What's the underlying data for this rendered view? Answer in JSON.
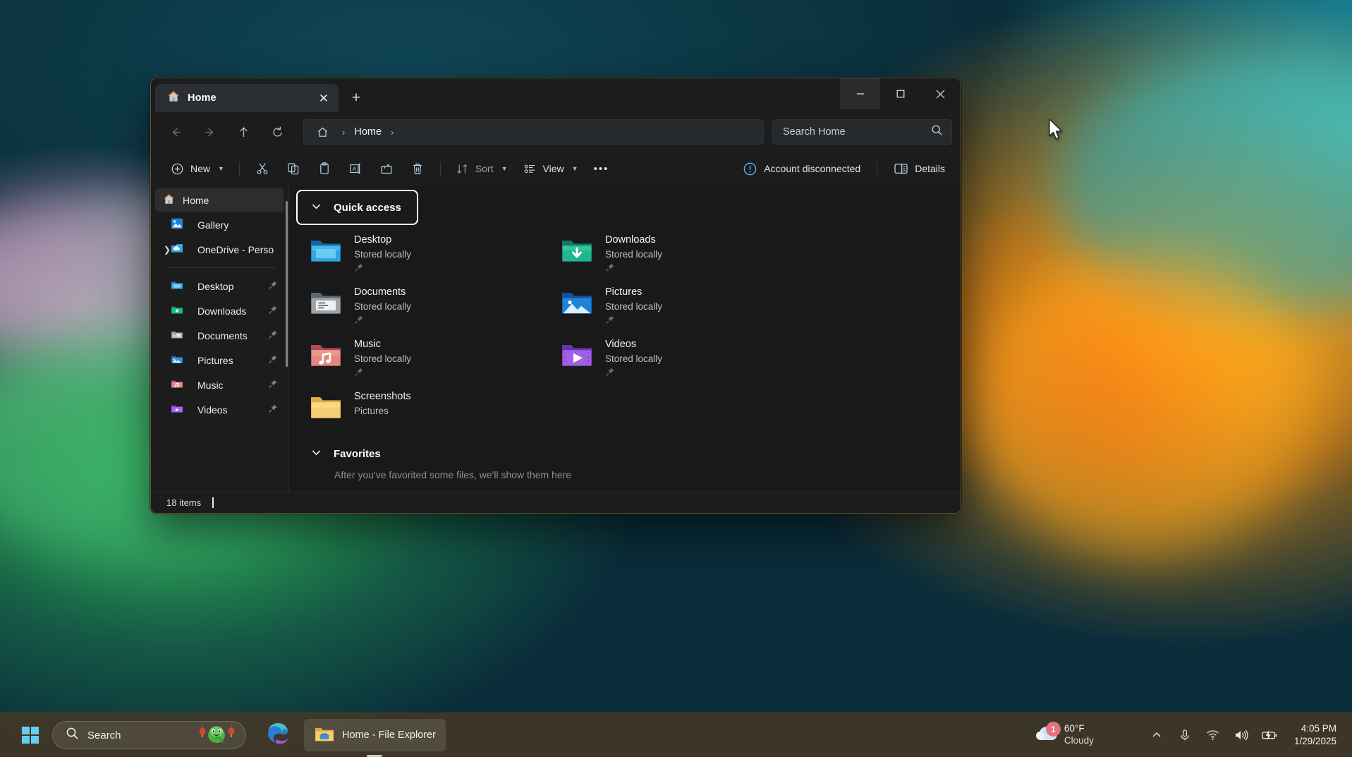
{
  "window": {
    "tab": {
      "title": "Home",
      "icon": "home-icon",
      "close_label": "✕"
    },
    "new_tab_label": "+",
    "controls": {
      "minimize": "minimize-icon",
      "maximize": "maximize-icon",
      "close": "close-icon"
    }
  },
  "nav": {
    "back": "back-arrow-icon",
    "forward": "forward-arrow-icon",
    "up": "up-arrow-icon",
    "refresh": "refresh-icon",
    "breadcrumb": {
      "home_icon": "home-icon",
      "sep1": "›",
      "label": "Home",
      "sep2": "›"
    },
    "search": {
      "placeholder": "Search Home",
      "icon": "search-icon"
    }
  },
  "commandbar": {
    "new_label": "New",
    "cut": "cut-icon",
    "copy": "copy-icon",
    "paste": "paste-icon",
    "rename": "rename-icon",
    "share": "share-icon",
    "delete": "delete-icon",
    "sort_label": "Sort",
    "view_label": "View",
    "more_label": "•••",
    "account_label": "Account disconnected",
    "details_label": "Details",
    "accent": "#4cc2ff"
  },
  "sidebar": {
    "items": [
      {
        "label": "Home",
        "icon": "home-icon",
        "selected": true,
        "expander": false,
        "pin": false,
        "indent": false
      },
      {
        "label": "Gallery",
        "icon": "gallery-icon",
        "selected": false,
        "expander": false,
        "pin": false,
        "indent": true
      },
      {
        "label": "OneDrive - Perso",
        "icon": "onedrive-icon",
        "selected": false,
        "expander": true,
        "pin": false,
        "indent": true
      }
    ],
    "pinned": [
      {
        "label": "Desktop",
        "icon": "desktop-folder-icon",
        "pin": true
      },
      {
        "label": "Downloads",
        "icon": "downloads-folder-icon",
        "pin": true
      },
      {
        "label": "Documents",
        "icon": "documents-folder-icon",
        "pin": true
      },
      {
        "label": "Pictures",
        "icon": "pictures-folder-icon",
        "pin": true
      },
      {
        "label": "Music",
        "icon": "music-folder-icon",
        "pin": true
      },
      {
        "label": "Videos",
        "icon": "videos-folder-icon",
        "pin": true
      }
    ]
  },
  "content": {
    "quick_access": {
      "title": "Quick access",
      "chevron": "chevron-down-icon",
      "focused": true,
      "items": [
        {
          "name": "Desktop",
          "sub": "Stored locally",
          "icon": "desktop-folder-icon",
          "pinned": true
        },
        {
          "name": "Downloads",
          "sub": "Stored locally",
          "icon": "downloads-folder-icon",
          "pinned": true
        },
        {
          "name": "Documents",
          "sub": "Stored locally",
          "icon": "documents-folder-icon",
          "pinned": true
        },
        {
          "name": "Pictures",
          "sub": "Stored locally",
          "icon": "pictures-folder-icon",
          "pinned": true
        },
        {
          "name": "Music",
          "sub": "Stored locally",
          "icon": "music-folder-icon",
          "pinned": true
        },
        {
          "name": "Videos",
          "sub": "Stored locally",
          "icon": "videos-folder-icon",
          "pinned": true
        },
        {
          "name": "Screenshots",
          "sub": "Pictures",
          "icon": "plain-folder-icon",
          "pinned": false
        }
      ]
    },
    "favorites": {
      "title": "Favorites",
      "chevron": "chevron-down-icon",
      "empty_text": "After you've favorited some files, we'll show them here"
    }
  },
  "status": {
    "items_count": "18 items"
  },
  "taskbar": {
    "start": "windows-logo-icon",
    "search": {
      "placeholder": "Search",
      "icon": "search-icon",
      "decoration": "snake-lantern-icon"
    },
    "edge": "edge-icon",
    "apps": [
      {
        "label": "Home - File Explorer",
        "icon": "folder-icon",
        "active": true
      }
    ],
    "tray": {
      "weather": {
        "temperature": "60°F",
        "condition": "Cloudy",
        "badge": "1",
        "icon": "cloud-icon"
      },
      "chevron_up": "chevron-up-icon",
      "mic": "microphone-icon",
      "wifi": "wifi-icon",
      "volume": "volume-icon",
      "battery": "battery-charging-icon",
      "clock": {
        "time": "4:05 PM",
        "date": "1/29/2025"
      }
    }
  }
}
